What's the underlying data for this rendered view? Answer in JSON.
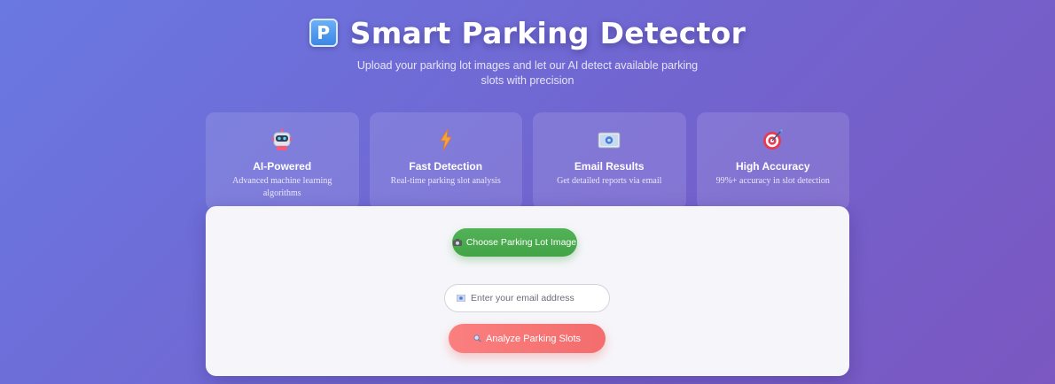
{
  "header": {
    "logo_letter": "P",
    "title": "Smart Parking Detector",
    "subtitle": "Upload your parking lot images and let our AI detect available parking slots with precision"
  },
  "features": [
    {
      "icon": "robot-icon",
      "title": "AI-Powered",
      "desc": "Advanced machine learning algorithms"
    },
    {
      "icon": "lightning-icon",
      "title": "Fast Detection",
      "desc": "Real-time parking slot analysis"
    },
    {
      "icon": "email-icon",
      "title": "Email Results",
      "desc": "Get detailed reports via email"
    },
    {
      "icon": "target-icon",
      "title": "High Accuracy",
      "desc": "99%+ accuracy in slot detection"
    }
  ],
  "upload": {
    "choose_label": "Choose Parking Lot Image",
    "email_placeholder": "Enter your email address",
    "analyze_label": "Analyze Parking Slots"
  },
  "colors": {
    "background_start": "#6a78e2",
    "background_end": "#7b57c1",
    "choose_button": "#4caf50",
    "analyze_button": "#f87777"
  }
}
